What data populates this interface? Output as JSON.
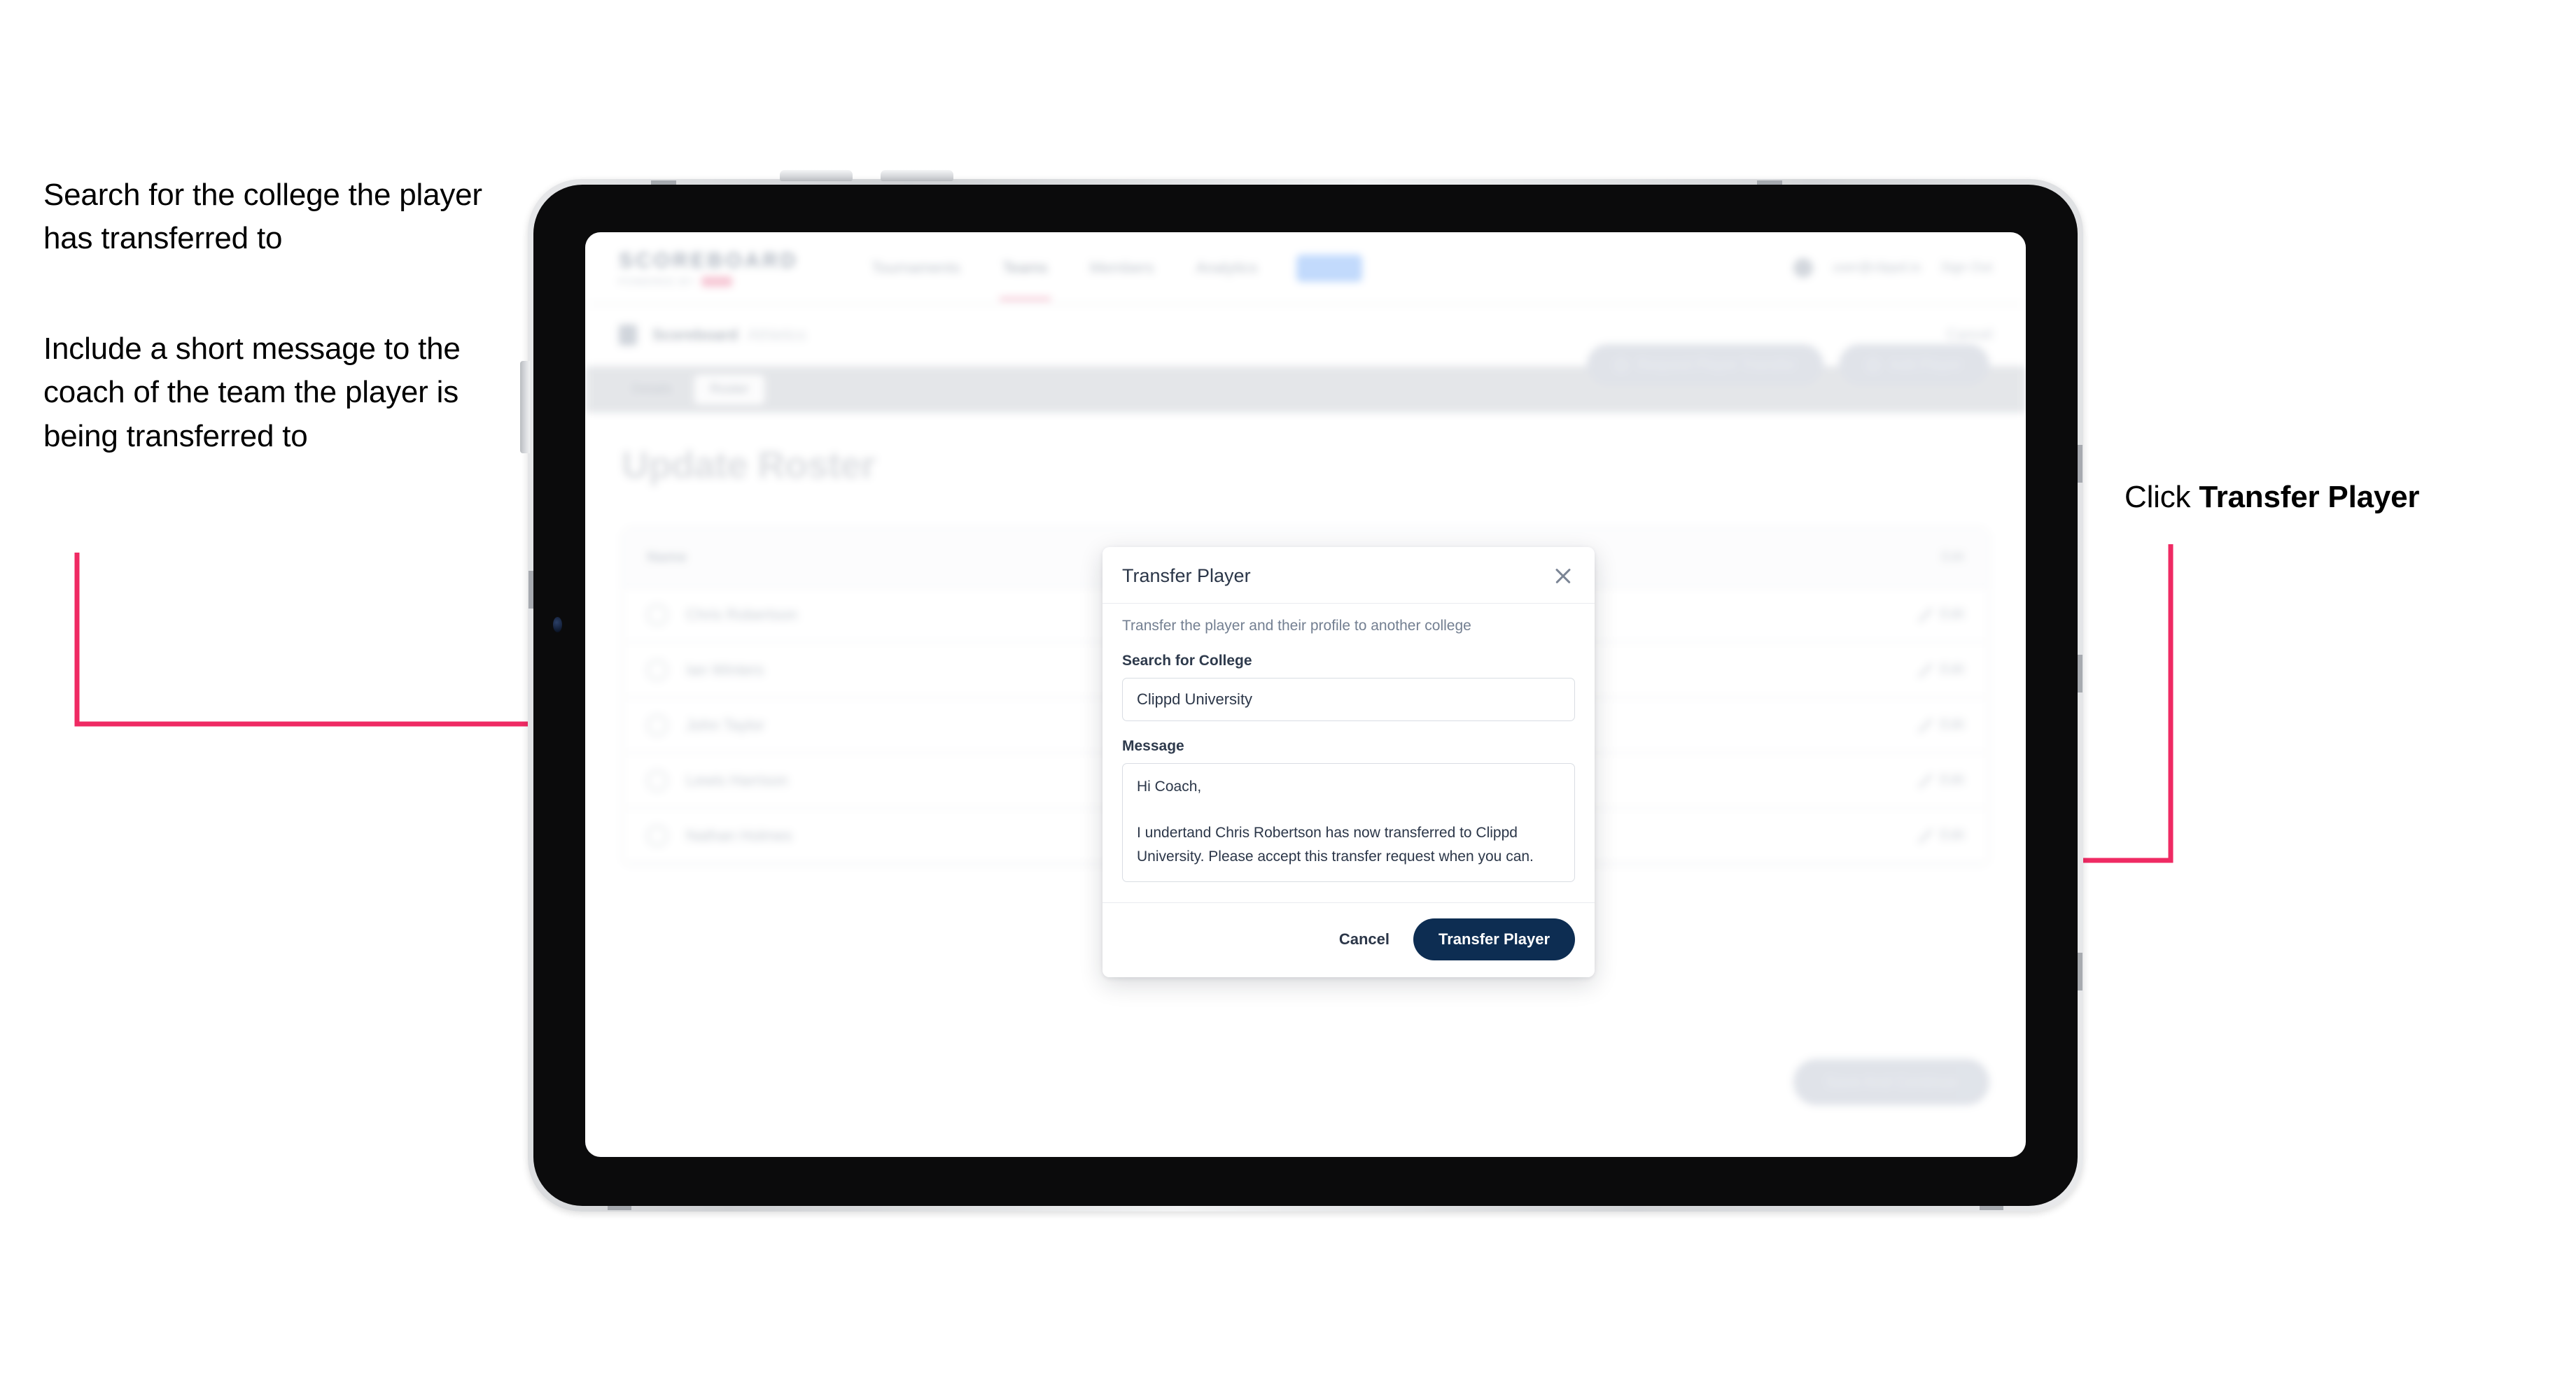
{
  "annotations": {
    "left_1": "Search for the college the player has transferred to",
    "left_2": "Include a short message to the coach of the team the player is being transferred to",
    "right_1_prefix": "Click ",
    "right_1_bold": "Transfer Player",
    "arrow_color": "#ef2a63"
  },
  "device": {
    "frame": "tablet",
    "bezel_color": "#0b0b0c",
    "edge_color": "#d7d9dc"
  },
  "app": {
    "brand": {
      "word": "SCOREBOARD",
      "sub": "POWERED BY",
      "pill_color": "#f2a7bd"
    },
    "nav": [
      {
        "label": "Tournaments",
        "active": false
      },
      {
        "label": "Teams",
        "active": true
      },
      {
        "label": "Members",
        "active": false
      },
      {
        "label": "Analytics",
        "active": false
      },
      {
        "label": "More",
        "active": false,
        "chip": true
      }
    ],
    "header_right": {
      "user": "user@clippd.io",
      "action": "Sign Out"
    },
    "breadcrumb": {
      "main": "Scoreboard",
      "sub": "Athletics",
      "right": "Cancel"
    },
    "segments": [
      {
        "label": "Details",
        "active": false
      },
      {
        "label": "Roster",
        "active": true
      }
    ],
    "page_title": "Update Roster",
    "actions": [
      {
        "label": "Request Player Transfer",
        "icon": "search-icon"
      },
      {
        "label": "Add Player",
        "icon": "plus-icon"
      }
    ],
    "roster": {
      "col_name": "Name",
      "col_right": "Edit",
      "rows": [
        {
          "name": "Chris Robertson",
          "edit_label": "Edit"
        },
        {
          "name": "Ian Winters",
          "edit_label": "Edit"
        },
        {
          "name": "John Taylor",
          "edit_label": "Edit"
        },
        {
          "name": "Lewis Harrison",
          "edit_label": "Edit"
        },
        {
          "name": "Nathan Holmes",
          "edit_label": "Edit"
        }
      ]
    },
    "bottom_cta": "Save And Continue"
  },
  "modal": {
    "title": "Transfer Player",
    "close_icon": "close-icon",
    "description": "Transfer the player and their profile to another college",
    "college_label": "Search for College",
    "college_value": "Clippd University",
    "college_placeholder": "Search for College",
    "message_label": "Message",
    "message_value": "Hi Coach,\n\nI undertand Chris Robertson has now transferred to Clippd University. Please accept this transfer request when you can.",
    "message_placeholder": "Message",
    "cancel_label": "Cancel",
    "submit_label": "Transfer Player",
    "submit_color": "#0d2d52"
  }
}
